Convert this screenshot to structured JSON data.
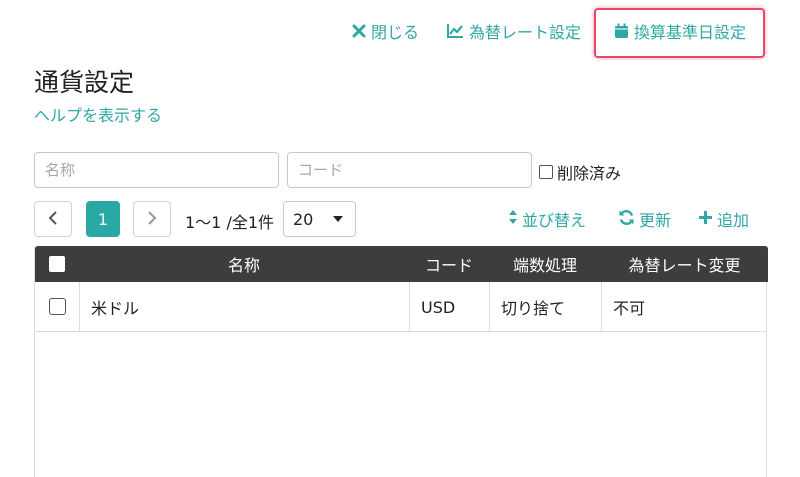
{
  "top_actions": {
    "close_label": "閉じる",
    "rate_label": "為替レート設定",
    "basedate_label": "換算基準日設定"
  },
  "page": {
    "title": "通貨設定",
    "help_link": "ヘルプを表示する"
  },
  "filters": {
    "name_placeholder": "名称",
    "code_placeholder": "コード",
    "deleted_label": "削除済み"
  },
  "pager": {
    "current_page": "1",
    "info": "1〜1 /全1件",
    "per_page": "20"
  },
  "tools": {
    "sort_label": "並び替え",
    "refresh_label": "更新",
    "add_label": "追加"
  },
  "table": {
    "columns": [
      "名称",
      "コード",
      "端数処理",
      "為替レート変更"
    ],
    "rows": [
      {
        "name": "米ドル",
        "code": "USD",
        "rounding": "切り捨て",
        "rate_change": "不可"
      }
    ]
  },
  "colors": {
    "accent": "#2fa7a4",
    "highlight_border": "#e8476b",
    "header_bg": "#3d3d3d"
  }
}
